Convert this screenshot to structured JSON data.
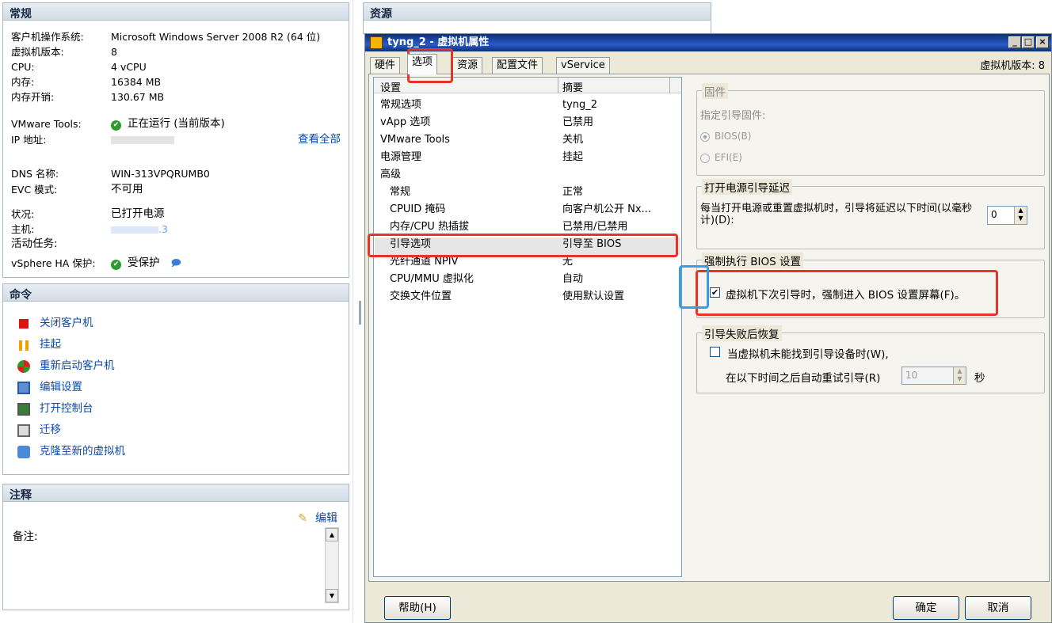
{
  "general": {
    "title": "常规",
    "rows": [
      {
        "k": "客户机操作系统:",
        "v": "Microsoft Windows Server 2008 R2 (64 位)"
      },
      {
        "k": "虚拟机版本:",
        "v": "8"
      },
      {
        "k": "CPU:",
        "v": "4 vCPU"
      },
      {
        "k": "内存:",
        "v": "16384 MB"
      },
      {
        "k": "内存开销:",
        "v": "130.67 MB"
      }
    ],
    "tools_label": "VMware Tools:",
    "tools_value": "正在运行 (当前版本)",
    "ip_label": "IP 地址:",
    "view_all": "查看全部",
    "dns_label": "DNS 名称:",
    "dns_value": "WIN-313VPQRUMB0",
    "evc_label": "EVC 模式:",
    "evc_value": "不可用",
    "status_label": "状况:",
    "status_value": "已打开电源",
    "host_label": "主机:",
    "host_value": ".3",
    "tasks_label": "活动任务:",
    "ha_label": "vSphere HA 保护:",
    "ha_value": "受保护"
  },
  "commands": {
    "title": "命令",
    "items": [
      "关闭客户机",
      "挂起",
      "重新启动客户机",
      "编辑设置",
      "打开控制台",
      "迁移",
      "克隆至新的虚拟机"
    ]
  },
  "notes": {
    "title": "注释",
    "edit": "编辑",
    "label": "备注:"
  },
  "resources": {
    "title": "资源"
  },
  "dialog": {
    "title": "tyng_2 - 虚拟机属性",
    "vm_version": "虚拟机版本: 8",
    "tabs": [
      "硬件",
      "选项",
      "资源",
      "配置文件",
      "vService"
    ],
    "col_setting": "设置",
    "col_summary": "摘要",
    "rows": [
      {
        "s": "常规选项",
        "v": "tyng_2"
      },
      {
        "s": "vApp 选项",
        "v": "已禁用"
      },
      {
        "s": "VMware Tools",
        "v": "关机"
      },
      {
        "s": "电源管理",
        "v": "挂起"
      },
      {
        "s": "高级",
        "v": ""
      },
      {
        "s": "常规",
        "v": "正常"
      },
      {
        "s": "CPUID 掩码",
        "v": "向客户机公开 Nx..."
      },
      {
        "s": "内存/CPU 热插拔",
        "v": "已禁用/已禁用"
      },
      {
        "s": "引导选项",
        "v": "引导至 BIOS"
      },
      {
        "s": "光纤通道 NPIV",
        "v": "无"
      },
      {
        "s": "CPU/MMU 虚拟化",
        "v": "自动"
      },
      {
        "s": "交换文件位置",
        "v": "使用默认设置"
      }
    ],
    "firmware": {
      "legend": "固件",
      "label": "指定引导固件:",
      "bios": "BIOS(B)",
      "efi": "EFI(E)"
    },
    "delay": {
      "legend": "打开电源引导延迟",
      "text": "每当打开电源或重置虚拟机时，引导将延迟以下时间(以毫秒计)(D):",
      "value": "0"
    },
    "force": {
      "legend": "强制执行 BIOS 设置",
      "text": "虚拟机下次引导时，强制进入 BIOS 设置屏幕(F)。"
    },
    "recovery": {
      "legend": "引导失败后恢复",
      "check": "当虚拟机未能找到引导设备时(W),",
      "retry": "在以下时间之后自动重试引导(R)",
      "value": "10",
      "unit": "秒"
    },
    "help": "帮助(H)",
    "ok": "确定",
    "cancel": "取消"
  }
}
